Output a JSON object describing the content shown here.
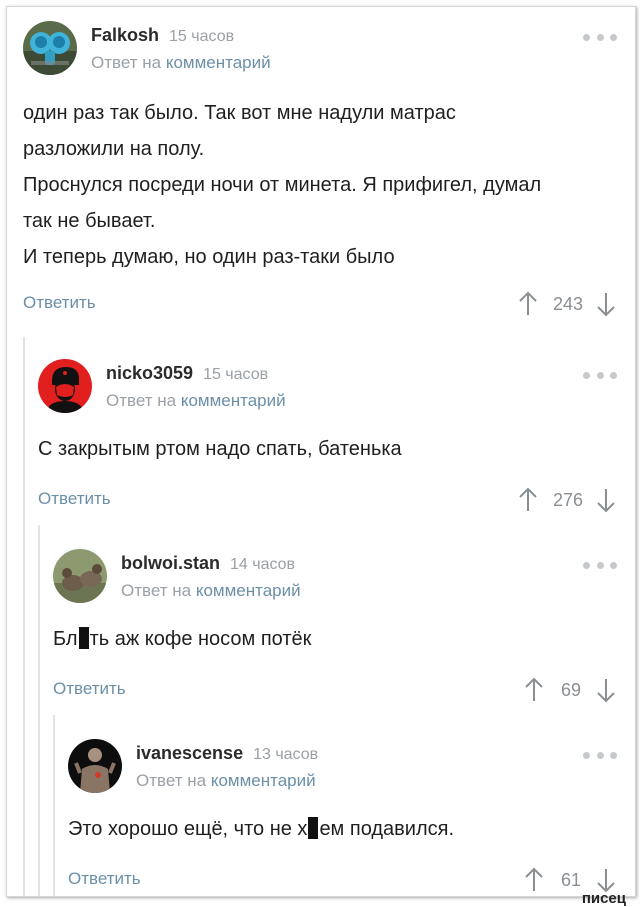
{
  "comments": [
    {
      "author": "Falkosh",
      "time": "15 часов",
      "reply_prefix": "Ответ на",
      "reply_link": "комментарий",
      "lines": [
        "один раз так было. Так вот мне надули матрас",
        "разложили на полу.",
        "Проснулся посреди ночи от минета. Я прифигел, думал",
        "так не бывает.",
        "И теперь думаю, но один раз-таки было"
      ],
      "reply_label": "Ответить",
      "score": "243"
    },
    {
      "author": "nicko3059",
      "time": "15 часов",
      "reply_prefix": "Ответ на",
      "reply_link": "комментарий",
      "text": "С закрытым ртом надо спать, батенька",
      "reply_label": "Ответить",
      "score": "276"
    },
    {
      "author": "bolwoi.stan",
      "time": "14 часов",
      "reply_prefix": "Ответ на",
      "reply_link": "комментарий",
      "text_before": "Бл",
      "text_after": "ть аж кофе носом потёк",
      "reply_label": "Ответить",
      "score": "69"
    },
    {
      "author": "ivanescense",
      "time": "13 часов",
      "reply_prefix": "Ответ на",
      "reply_link": "комментарий",
      "text_before": "Это хорошо ещё, что не х",
      "text_after": "ем подавился.",
      "reply_label": "Ответить",
      "score": "61"
    }
  ],
  "icons": {
    "more": "more-dots-icon",
    "upvote": "arrow-up-icon",
    "downvote": "arrow-down-icon"
  },
  "colors": {
    "link": "#6b8fa8",
    "muted": "#9aa0a6",
    "text": "#1f1f1f"
  },
  "watermark": "писец"
}
